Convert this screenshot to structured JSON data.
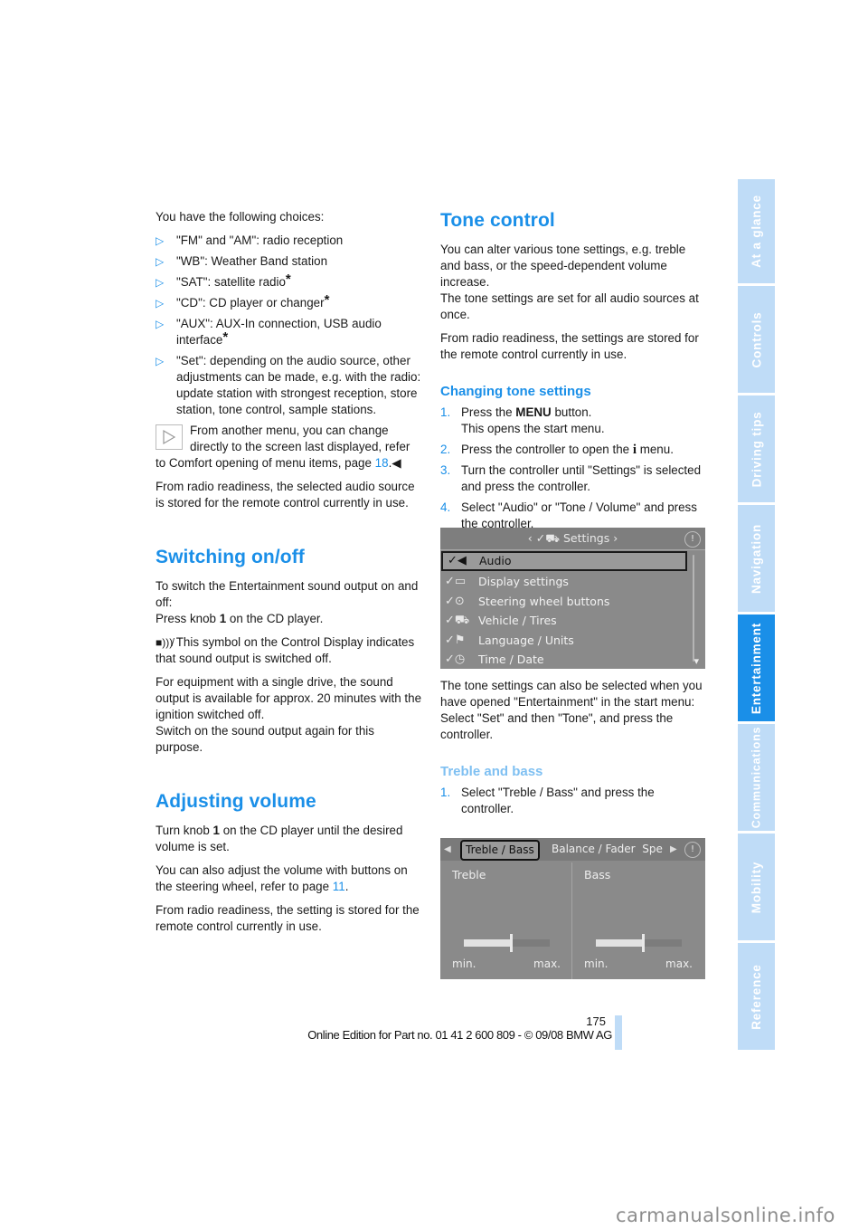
{
  "left_column": {
    "intro": "You have the following choices:",
    "choices": [
      {
        "text": "\"FM\" and \"AM\": radio reception",
        "asterisk": false
      },
      {
        "text": "\"WB\": Weather Band station",
        "asterisk": false
      },
      {
        "text": "\"SAT\": satellite radio",
        "asterisk": true
      },
      {
        "text": "\"CD\": CD player or changer",
        "asterisk": true
      },
      {
        "text": "\"AUX\": AUX-In connection, USB audio interface",
        "asterisk": true
      },
      {
        "text": "\"Set\": depending on the audio source, other adjustments can be made, e.g. with the radio: update station with strongest reception, store station, tone control, sample stations.",
        "asterisk": false
      }
    ],
    "note": {
      "text": "From another menu, you can change directly to the screen last displayed, refer to Comfort opening of menu items, page ",
      "page_link": "18",
      "end_mark": ".◀"
    },
    "radio_readiness": "From radio readiness, the selected audio source is stored for the remote control currently in use.",
    "switching": {
      "heading": "Switching on/off",
      "p1_a": "To switch the Entertainment sound output on and off:",
      "p1_b_pre": "Press knob ",
      "p1_b_bold": "1",
      "p1_b_post": " on the CD player.",
      "p2": " This symbol on the Control Display indicates that sound output is switched off.",
      "p3_a": "For equipment with a single drive, the sound output is available for approx. 20 minutes with the ignition switched off.",
      "p3_b": "Switch on the sound output again for this purpose."
    },
    "volume": {
      "heading": "Adjusting volume",
      "p1_pre": "Turn knob ",
      "p1_bold": "1",
      "p1_post": " on the CD player until the desired volume is set.",
      "p2_pre": "You can also adjust the volume with buttons on the steering wheel, refer to page ",
      "p2_link": "11",
      "p2_post": ".",
      "p3": "From radio readiness, the setting is stored for the remote control currently in use."
    }
  },
  "right_column": {
    "tone": {
      "heading": "Tone control",
      "p1_a": "You can alter various tone settings, e.g. treble and bass, or the speed-dependent volume increase.",
      "p1_b": "The tone settings are set for all audio sources at once.",
      "p2": "From radio readiness, the settings are stored for the remote control currently in use."
    },
    "changing": {
      "heading": "Changing tone settings",
      "steps": [
        {
          "n": "1.",
          "pre": "Press the ",
          "bold": "MENU",
          "post": " button.",
          "line2": "This opens the start menu."
        },
        {
          "n": "2.",
          "pre": "Press the controller to open the ",
          "bold": "i",
          "post": " menu.",
          "line2": ""
        },
        {
          "n": "3.",
          "pre": "Turn the controller until \"Settings\" is selected and press the controller.",
          "bold": "",
          "post": "",
          "line2": ""
        },
        {
          "n": "4.",
          "pre": "Select \"Audio\" or \"Tone / Volume\" and press the controller.",
          "bold": "",
          "post": "",
          "line2": ""
        }
      ]
    },
    "settings_screen": {
      "title": "Settings",
      "items": [
        {
          "label": "Audio",
          "selected": true
        },
        {
          "label": "Display settings",
          "selected": false
        },
        {
          "label": "Steering wheel buttons",
          "selected": false
        },
        {
          "label": "Vehicle / Tires",
          "selected": false
        },
        {
          "label": "Language / Units",
          "selected": false
        },
        {
          "label": "Time / Date",
          "selected": false
        }
      ]
    },
    "alt_path": {
      "p1": "The tone settings can also be selected when you have opened \"Entertainment\" in the start menu:",
      "p2": "Select \"Set\" and then \"Tone\", and press the controller."
    },
    "treble_bass": {
      "heading": "Treble and bass",
      "step_n": "1.",
      "step": "Select \"Treble / Bass\" and press the controller."
    },
    "tone_screen": {
      "tabs": [
        "Treble / Bass",
        "Balance / Fader",
        "Spe"
      ],
      "selected_tab": "Treble / Bass",
      "panes": [
        {
          "label": "Treble",
          "min": "min.",
          "max": "max.",
          "level": 0.55
        },
        {
          "label": "Bass",
          "min": "min.",
          "max": "max.",
          "level": 0.55
        }
      ]
    }
  },
  "side_tabs": [
    {
      "label": "At a glance",
      "active": false
    },
    {
      "label": "Controls",
      "active": false
    },
    {
      "label": "Driving tips",
      "active": false
    },
    {
      "label": "Navigation",
      "active": false
    },
    {
      "label": "Entertainment",
      "active": true
    },
    {
      "label": "Communications",
      "active": false
    },
    {
      "label": "Mobility",
      "active": false
    },
    {
      "label": "Reference",
      "active": false
    }
  ],
  "footer": {
    "page_number": "175",
    "edition": "Online Edition for Part no. 01 41 2 600 809 - © 09/08 BMW AG"
  },
  "watermark": "carmanualsonline.info",
  "colors": {
    "accent": "#1a8fe8",
    "side_tab": "#bfdcf7"
  }
}
